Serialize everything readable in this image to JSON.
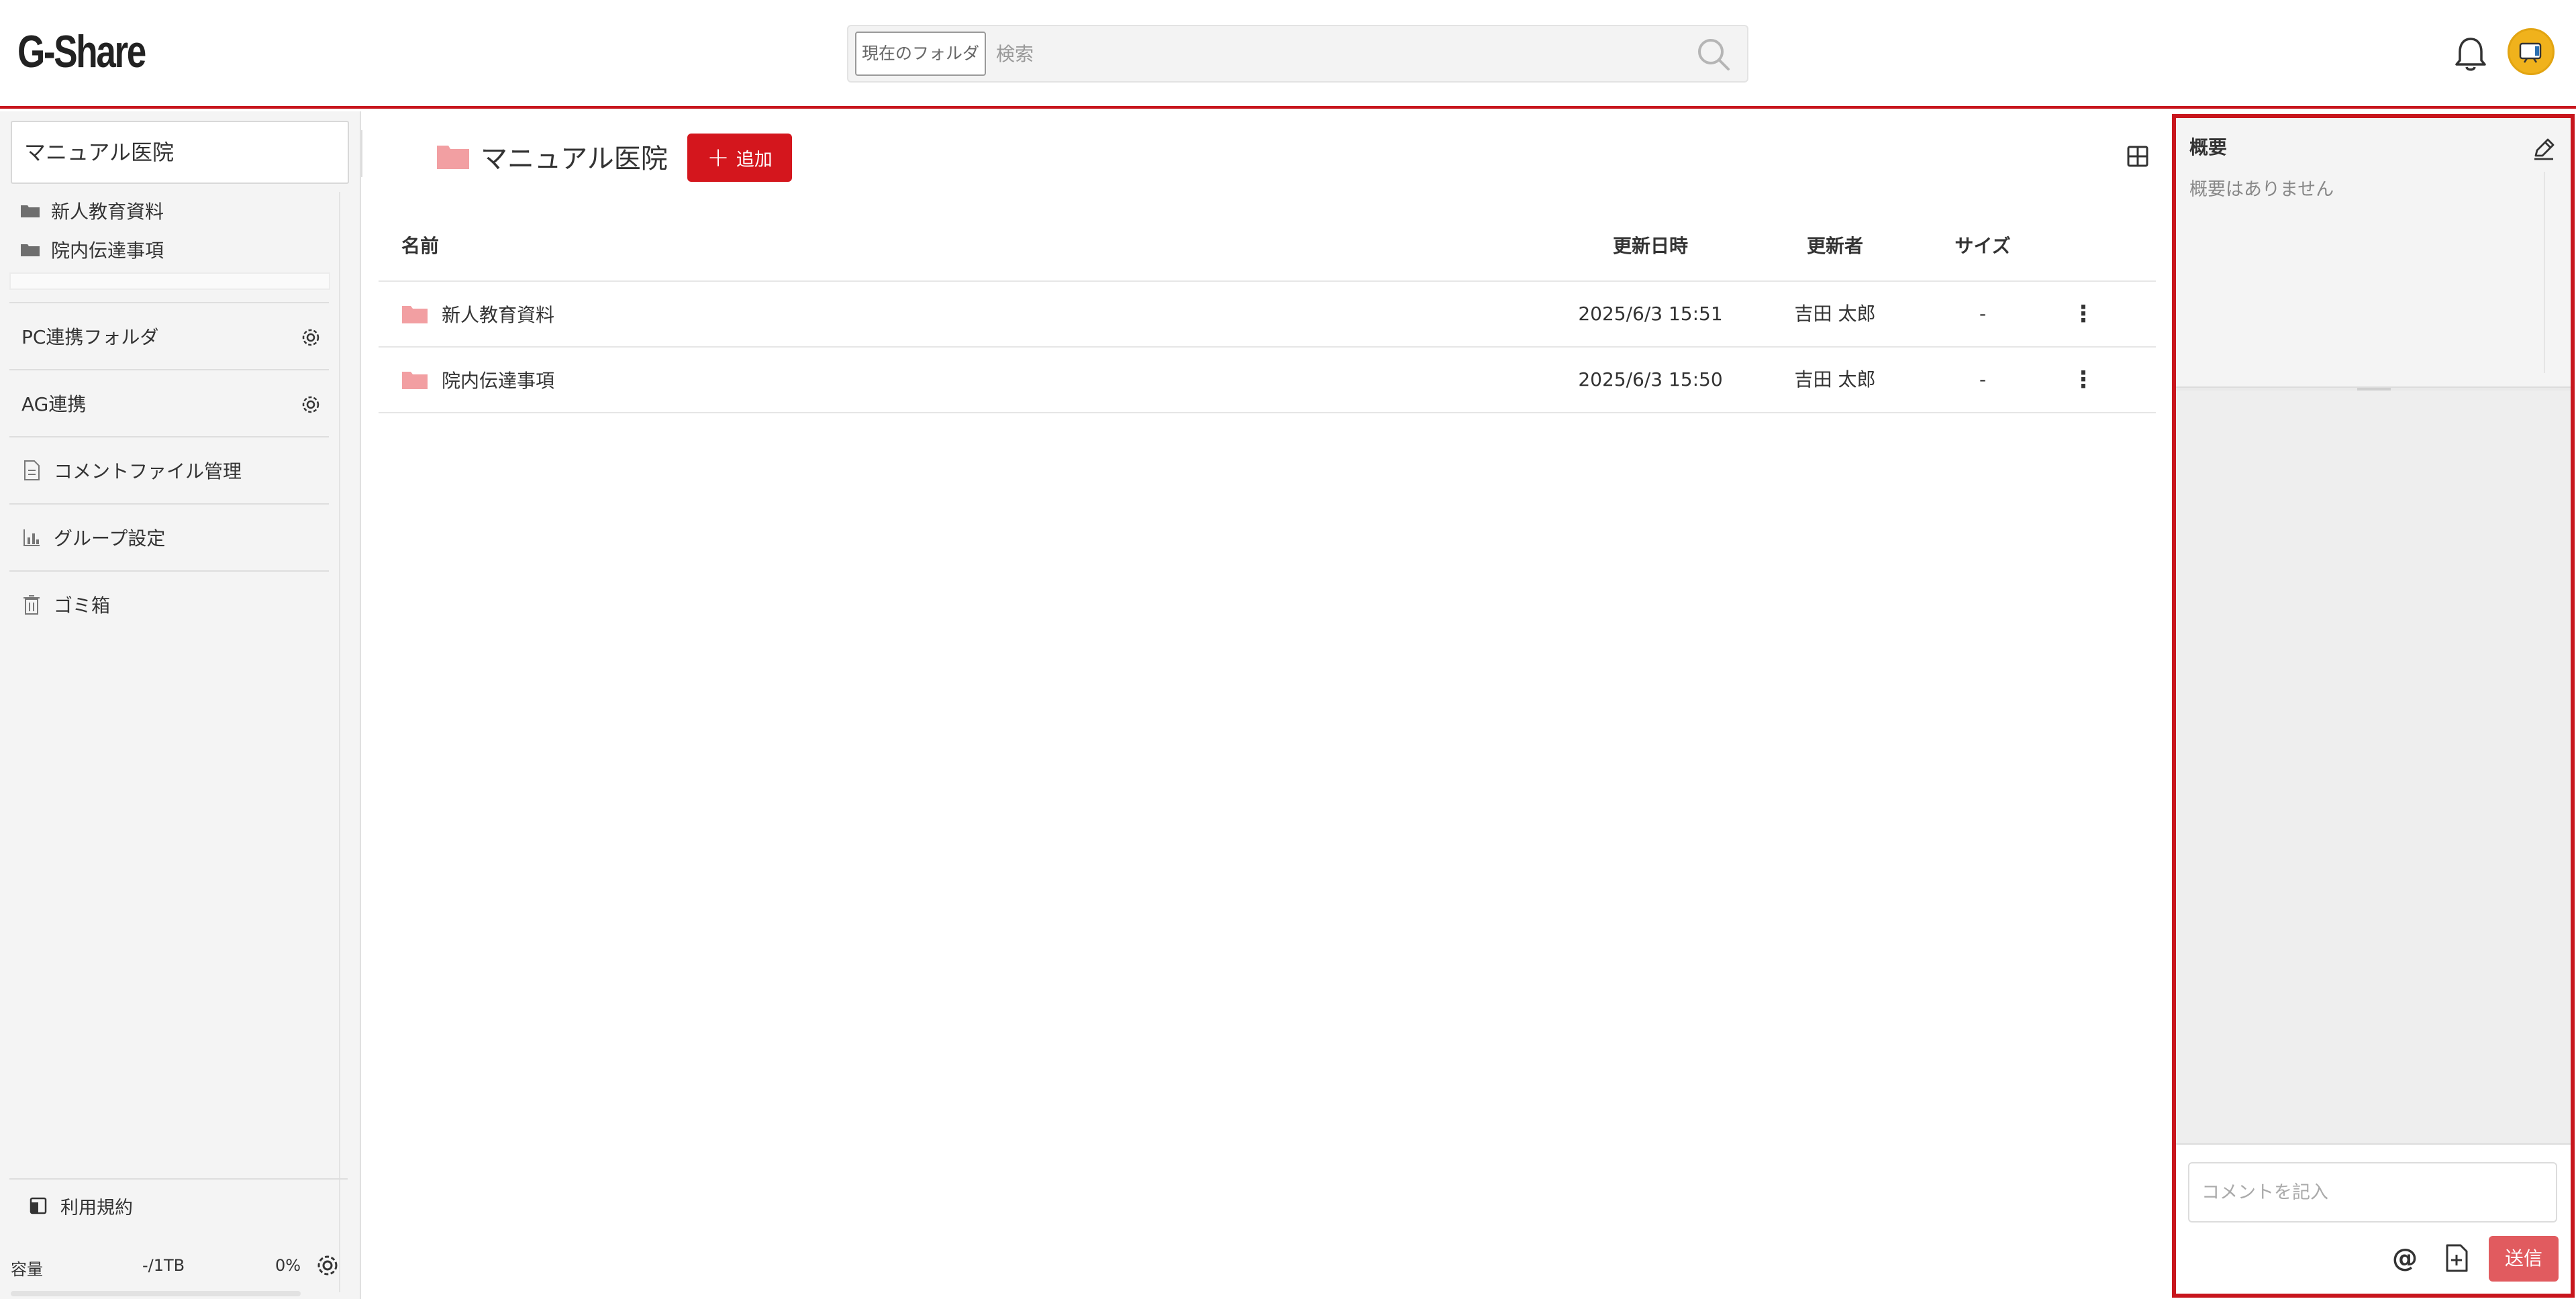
{
  "header": {
    "logo": "G-Share",
    "search_scope": "現在のフォルダ",
    "search_placeholder": "検索",
    "icons": [
      "search-icon",
      "bell-icon",
      "avatar"
    ]
  },
  "sidebar": {
    "current_folder": "マニュアル医院",
    "tree": [
      {
        "label": "新人教育資料",
        "icon": "folder-icon"
      },
      {
        "label": "院内伝達事項",
        "icon": "folder-icon"
      }
    ],
    "menu": [
      {
        "label": "PC連携フォルダ",
        "icon": "gear-icon"
      },
      {
        "label": "AG連携",
        "icon": "gear-icon"
      },
      {
        "label": "コメントファイル管理",
        "icon": "document-icon"
      },
      {
        "label": "グループ設定",
        "icon": "chart-icon"
      },
      {
        "label": "ゴミ箱",
        "icon": "trash-icon"
      }
    ],
    "terms_label": "利用規約",
    "capacity": {
      "label": "容量",
      "value": "-/1TB",
      "percent": "0%",
      "fraction": 0
    }
  },
  "main": {
    "title": "マニュアル医院",
    "add_label": "追加",
    "columns": {
      "name": "名前",
      "updated": "更新日時",
      "updater": "更新者",
      "size": "サイズ"
    },
    "rows": [
      {
        "name": "新人教育資料",
        "updated": "2025/6/3 15:51",
        "updater": "吉田 太郎",
        "size": "-",
        "menu": "⋮"
      },
      {
        "name": "院内伝達事項",
        "updated": "2025/6/3 15:50",
        "updater": "吉田 太郎",
        "size": "-",
        "menu": "⋮"
      }
    ]
  },
  "panel": {
    "summary_title": "概要",
    "summary_text": "概要はありません",
    "comment_placeholder": "コメントを記入",
    "mention_symbol": "@",
    "send_label": "送信"
  },
  "colors": {
    "accent": "#d4161d",
    "panel_border": "#c8161d",
    "folder": "#f29fa2",
    "send": "#e15b5f",
    "avatar": "#f0b21c"
  }
}
